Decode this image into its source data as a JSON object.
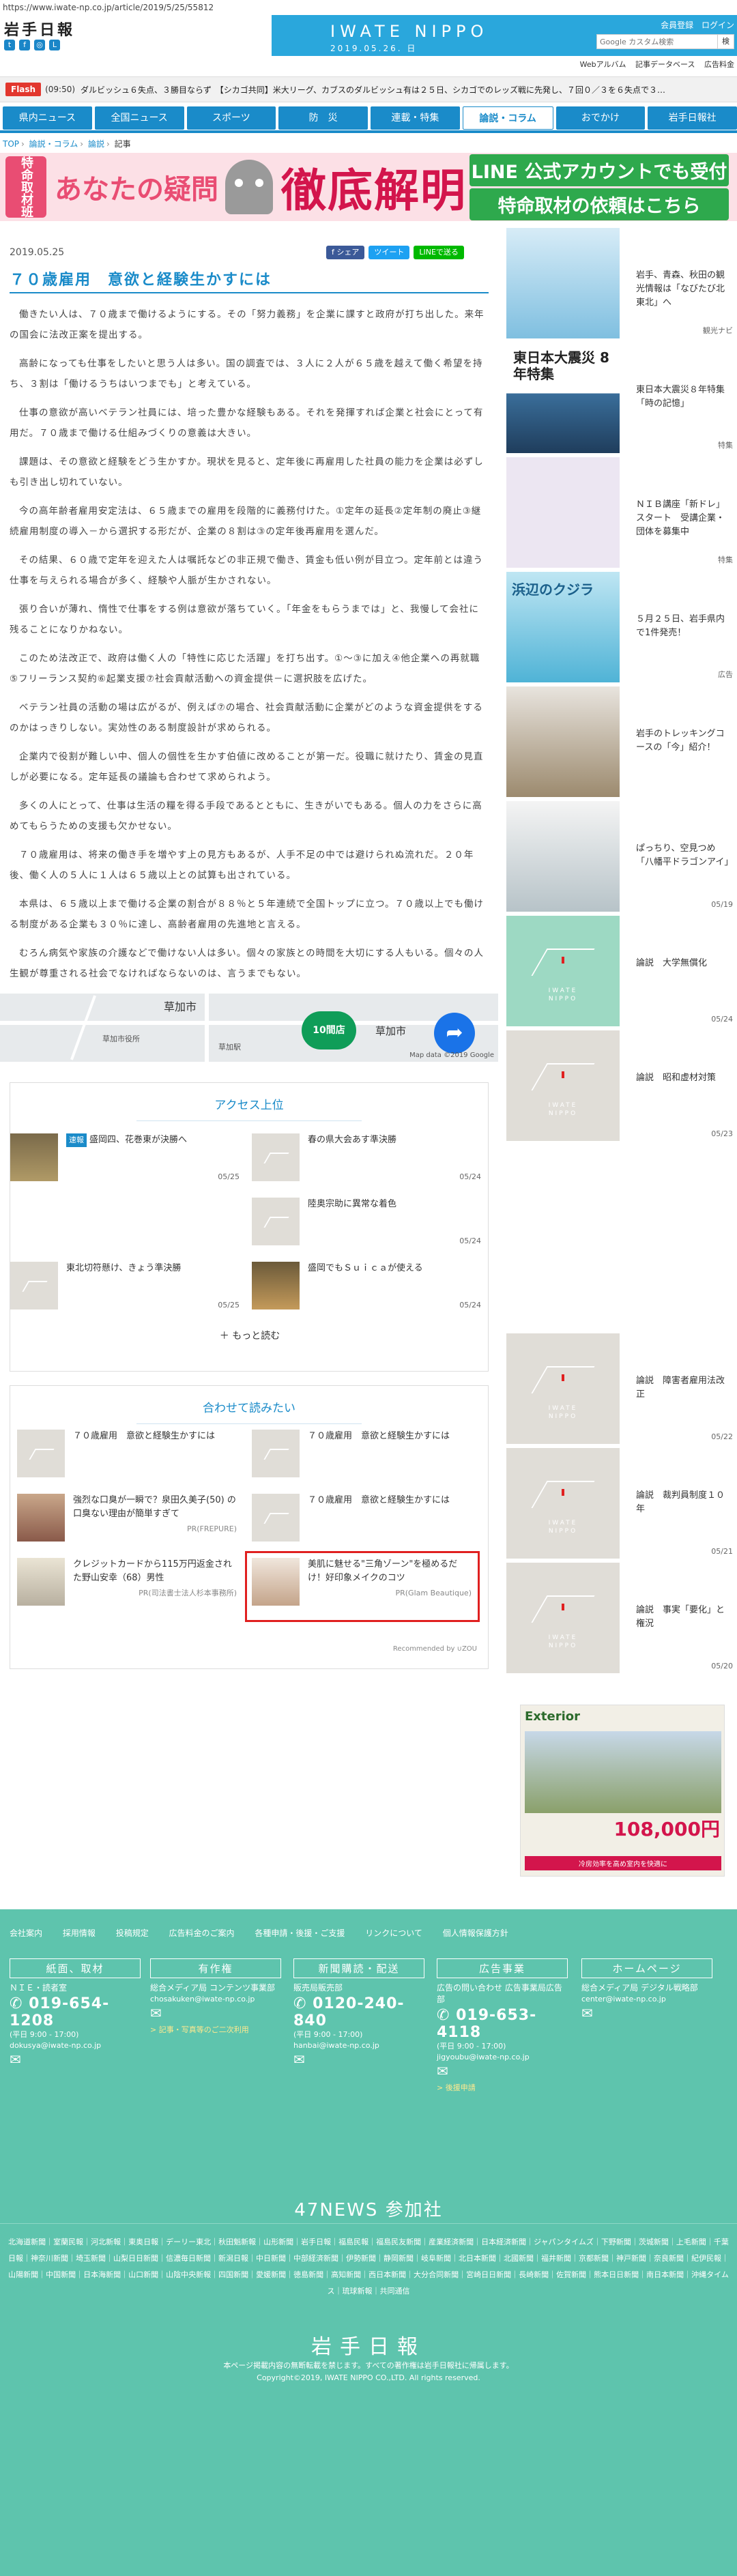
{
  "url": "https://www.iwate-np.co.jp/article/2019/5/25/55812",
  "logo_small": "岩手日報",
  "hero": {
    "logo": "IWATE NIPPO",
    "date": "2019.05.26. 日"
  },
  "login": {
    "member": "会員登録",
    "login": "ログイン"
  },
  "search": {
    "placeholder": "Google カスタム検索",
    "button": "検"
  },
  "util_links": [
    "Webアルバム",
    "記事データベース",
    "広告料金"
  ],
  "flash": {
    "label": "Flash",
    "time": "(09:50)",
    "text": "ダルビッシュ６失点、３勝目ならず　【シカゴ共同】米大リーグ、カブスのダルビッシュ有は２５日、シカゴでのレッズ戦に先発し、７回０／３を６失点で３…"
  },
  "gnav": [
    "県内ニュース",
    "全国ニュース",
    "スポーツ",
    "防　災",
    "連載・特集",
    "論説・コラム",
    "おでかけ",
    "岩手日報社"
  ],
  "gnav_active": "論説・コラム",
  "breadcrumb": [
    "TOP",
    "論説・コラム",
    "論説",
    "記事"
  ],
  "banner": {
    "badge": "特命取材班",
    "a": "あなたの疑問",
    "b": "徹底解明",
    "line1": "LINE 公式アカウントでも受付",
    "line2": "特命取材の依頼はこちら"
  },
  "article": {
    "date": "2019.05.25",
    "share": [
      "f シェア",
      "ツイート",
      "LINEで送る"
    ],
    "title": "７０歳雇用　意欲と経験生かすには",
    "paragraphs": [
      "働きたい人は、７０歳まで働けるようにする。その「努力義務」を企業に課すと政府が打ち出した。来年の国会に法改正案を提出する。",
      "高齢になっても仕事をしたいと思う人は多い。国の調査では、３人に２人が６５歳を越えて働く希望を持ち、３割は「働けるうちはいつまでも」と考えている。",
      "仕事の意欲が高いベテラン社員には、培った豊かな経験もある。それを発揮すれば企業と社会にとって有用だ。７０歳まで働ける仕組みづくりの意義は大きい。",
      "課題は、その意欲と経験をどう生かすか。現状を見ると、定年後に再雇用した社員の能力を企業は必ずしも引き出し切れていない。",
      "今の高年齢者雇用安定法は、６５歳までの雇用を段階的に義務付けた。①定年の延長②定年制の廃止③継続雇用制度の導入－から選択する形だが、企業の８割は③の定年後再雇用を選んだ。",
      "その結果、６０歳で定年を迎えた人は嘱託などの非正規で働き、賃金も低い例が目立つ。定年前とは違う仕事を与えられる場合が多く、経験や人脈が生かされない。",
      "張り合いが薄れ、惰性で仕事をする例は意欲が落ちていく。「年金をもらうまでは」と、我慢して会社に残ることになりかねない。",
      "このため法改正で、政府は働く人の「特性に応じた活躍」を打ち出す。①～③に加え④他企業への再就職⑤フリーランス契約⑥起業支援⑦社会貢献活動への資金提供－に選択肢を広げた。",
      "ベテラン社員の活動の場は広がるが、例えば⑦の場合、社会貢献活動に企業がどのような資金提供をするのかはっきりしない。実効性のある制度設計が求められる。",
      "企業内で役割が難しい中、個人の個性を生かす伯値に改めることが第一だ。役職に就けたり、賃金の見直しが必要になる。定年延長の議論も合わせて求められよう。",
      "多くの人にとって、仕事は生活の糧を得る手段であるとともに、生きがいでもある。個人の力をさらに高めてもらうための支援も欠かせない。",
      "７０歳雇用は、将来の働き手を増やす上の見方もあるが、人手不足の中では避けられぬ流れだ。２０年後、働く人の５人に１人は６５歳以上との試算も出されている。",
      "本県は、６５歳以上まで働ける企業の割合が８８％と５年連続で全国トップに立つ。７０歳以上でも働ける制度がある企業も３０％に達し、高齢者雇用の先進地と言える。",
      "むろん病気や家族の介護などで働けない人は多い。個々の家族との時間を大切にする人もいる。個々の人生観が尊重される社会でなければならないのは、言うまでもない。"
    ]
  },
  "map": {
    "city": "草加市",
    "chip": "10間店",
    "dest": "草加市",
    "label1": "草加市役所",
    "label2": "草加駅",
    "credit": "Map data ©2019 Google"
  },
  "access": {
    "title": "アクセス上位",
    "items": [
      {
        "new": "速報",
        "text": "盛岡四、花巻東が決勝へ",
        "date": "05/25"
      },
      {
        "text": "春の県大会あす準決勝",
        "date": "05/24"
      },
      {
        "text": "陸奥宗助に異常な着色",
        "date": "05/24"
      },
      {
        "text": "東北切符懸け、きょう準決勝",
        "date": "05/25"
      },
      {
        "text": "盛岡でもＳｕｉｃａが使える",
        "date": "05/24"
      }
    ],
    "more": "もっと読む"
  },
  "recommend": {
    "title": "合わせて読みたい",
    "items": [
      {
        "text": "７０歳雇用　意欲と経験生かすには",
        "src": ""
      },
      {
        "text": "７０歳雇用　意欲と経験生かすには",
        "src": ""
      },
      {
        "text": "強烈な口臭が一瞬で？泉田久美子(50) の口臭ない理由が簡単すぎて",
        "src": "PR(FREPURE)"
      },
      {
        "text": "７０歳雇用　意欲と経験生かすには",
        "src": ""
      },
      {
        "text": "クレジットカードから115万円返金された野山安幸（68）男性",
        "src": "PR(司法書士法人杉本事務所)"
      },
      {
        "text": "美肌に魅せる\"三角ゾーン\"を極めるだけ！好印象メイクのコツ",
        "src": "PR(Glam Beautique)"
      }
    ],
    "credit": "Recommended by ∪ZOU"
  },
  "side": [
    {
      "text": "岩手、青森、秋田の観光情報は「なびたび北東北」へ",
      "date": "観光ナビ"
    },
    {
      "text": "東日本大震災８年特集「時の記憶」",
      "date": "特集"
    },
    {
      "text": "ＮＩＢ講座「新ドレ」スタート　受講企業・団体を募集中",
      "date": "特集"
    },
    {
      "text": "５月２５日、岩手県内で1件発売！",
      "date": "広告"
    },
    {
      "text": "岩手のトレッキングコースの「今」紹介！",
      "date": ""
    },
    {
      "text": "ぱっちり、空見つめ「八幡平ドラゴンアイ」",
      "date": "05/19"
    },
    {
      "text": "論説　大学無償化",
      "date": "05/24"
    },
    {
      "text": "論説　昭和虚材対策",
      "date": "05/23"
    },
    {
      "text": "論説　障害者雇用法改正",
      "date": "05/22"
    },
    {
      "text": "論説　裁判員制度１０年",
      "date": "05/21"
    },
    {
      "text": "論説　事実「要化」と権況",
      "date": "05/20"
    }
  ],
  "side_big_titles": {
    "quake": "東日本大震災 8年特集",
    "whale": "浜辺のクジラ"
  },
  "ad": {
    "title": "Exterior",
    "price": "108,000円",
    "sub": "冷房効率を高め室内を快適に"
  },
  "footer": {
    "links": [
      "会社案内",
      "採用情報",
      "投稿規定",
      "広告料金のご案内",
      "各種申請・後援・ご支援",
      "リンクについて",
      "個人情報保護方針"
    ],
    "cols": [
      {
        "head": "紙面、取材",
        "sub": "ＮＩＥ・読者室",
        "phone": "019-654-1208",
        "hours": "(平日 9:00 - 17:00)",
        "mail": "dokusya@iwate-np.co.jp",
        "link": ""
      },
      {
        "head": "有作権",
        "sub": "総合メディア局 コンテンツ事業部",
        "phone": "",
        "hours": "",
        "mail": "chosakuken@iwate-np.co.jp",
        "link": "> 記事・写真等のご二次利用"
      },
      {
        "head": "新聞購読・配送",
        "sub": "販売局販売部",
        "phone": "0120-240-840",
        "hours": "(平日 9:00 - 17:00)",
        "mail": "hanbai@iwate-np.co.jp",
        "link": ""
      },
      {
        "head": "広告事業",
        "sub": "広告の問い合わせ 広告事業局広告部",
        "phone": "019-653-4118",
        "hours": "(平日 9:00 - 17:00)",
        "mail": "jigyoubu@iwate-np.co.jp",
        "link": "> 後援申請"
      },
      {
        "head": "ホームページ",
        "sub": "総合メディア局 デジタル戦略部",
        "phone": "",
        "hours": "",
        "mail": "center@iwate-np.co.jp",
        "link": ""
      }
    ],
    "news47": "47NEWS 参加社",
    "news47_list": "北海道新聞｜室蘭民報｜河北新報｜東奥日報｜デーリー東北｜秋田魁新報｜山形新聞｜岩手日報｜福島民報｜福島民友新聞｜産業経済新聞｜日本経済新聞｜ジャパンタイムズ｜下野新聞｜茨城新聞｜上毛新聞｜千葉日報｜神奈川新聞｜埼玉新聞｜山梨日日新聞｜信濃毎日新聞｜新潟日報｜中日新聞｜中部経済新聞｜伊勢新聞｜静岡新聞｜岐阜新聞｜北日本新聞｜北國新聞｜福井新聞｜京都新聞｜神戸新聞｜奈良新聞｜紀伊民報｜山陽新聞｜中国新聞｜日本海新聞｜山口新聞｜山陰中央新報｜四国新聞｜愛媛新聞｜徳島新聞｜高知新聞｜西日本新聞｜大分合同新聞｜宮崎日日新聞｜長崎新聞｜佐賀新聞｜熊本日日新聞｜南日本新聞｜沖縄タイムス｜琉球新報｜共同通信",
    "logo": "岩手日報",
    "notice": "本ページ掲載内容の無断転載を禁じます。すべての著作権は岩手日報社に帰属します。",
    "copyright": "Copyright©2019, IWATE NIPPO CO.,LTD. All rights reserved."
  }
}
